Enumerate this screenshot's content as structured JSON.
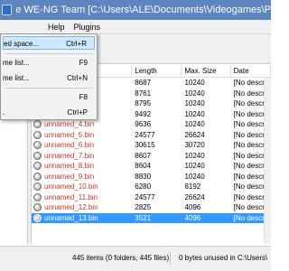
{
  "window": {
    "title": "e WE-NG Team [C:\\Users\\ALE\\Documents\\Videogames\\PSO\\"
  },
  "menubar": {
    "items": [
      "Help",
      "Plugins"
    ]
  },
  "dropdown": {
    "items": [
      {
        "label": "ed space...",
        "shortcut": "Ctrl+R"
      },
      {
        "label": "me list...",
        "shortcut": "F9"
      },
      {
        "label": "me list...",
        "shortcut": "Ctrl+N"
      },
      {
        "label": "",
        "shortcut": "F8"
      },
      {
        "label": ".",
        "shortcut": "Ctrl+P"
      }
    ]
  },
  "list": {
    "columns": {
      "name": "",
      "length": "Length",
      "max_size": "Max. Size",
      "date": "Date"
    },
    "rows": [
      {
        "name": "",
        "length": "8687",
        "max_size": "10240",
        "date": "[No descri"
      },
      {
        "name": "",
        "length": "8761",
        "max_size": "10240",
        "date": "[No descri"
      },
      {
        "name": "",
        "length": "8795",
        "max_size": "10240",
        "date": "[No descri"
      },
      {
        "name": "",
        "length": "9492",
        "max_size": "10240",
        "date": "[No descri"
      },
      {
        "name": "unnamed_4.bin",
        "length": "9636",
        "max_size": "10240",
        "date": "[No descri"
      },
      {
        "name": "unnamed_5.bin",
        "length": "24577",
        "max_size": "26624",
        "date": "[No descri"
      },
      {
        "name": "unnamed_6.bin",
        "length": "30615",
        "max_size": "30720",
        "date": "[No descri"
      },
      {
        "name": "unnamed_7.bin",
        "length": "8607",
        "max_size": "10240",
        "date": "[No descri"
      },
      {
        "name": "unnamed_8.bin",
        "length": "8604",
        "max_size": "10240",
        "date": "[No descri"
      },
      {
        "name": "unnamed_9.bin",
        "length": "8830",
        "max_size": "10240",
        "date": "[No descri"
      },
      {
        "name": "unnamed_10.bin",
        "length": "6280",
        "max_size": "8192",
        "date": "[No descri"
      },
      {
        "name": "unnamed_11.bin",
        "length": "24577",
        "max_size": "26624",
        "date": "[No descri"
      },
      {
        "name": "unnamed_12.bin",
        "length": "2825",
        "max_size": "4096",
        "date": "[No descri"
      },
      {
        "name": "unnamed_13.bin",
        "length": "3521",
        "max_size": "4096",
        "date": "[No descri"
      }
    ],
    "selected_index": 13
  },
  "status": {
    "items": "445 items (0 folders, 445 files)",
    "unused": "0 bytes unused in C:\\Users\\"
  },
  "colors": {
    "titlebar": "#5d86c1",
    "selection": "#3399ff",
    "file_name": "#c0392b"
  }
}
